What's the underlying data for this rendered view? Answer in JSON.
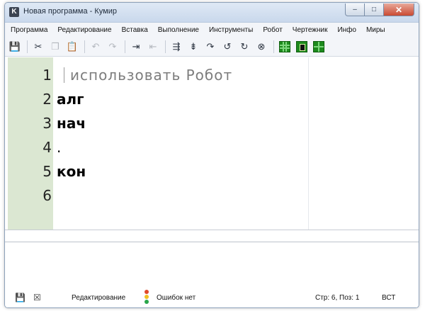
{
  "window": {
    "title": "Новая программа - Кумир",
    "app_icon_letter": "K",
    "minimize": "‒",
    "maximize": "□",
    "close": "✕"
  },
  "menu": [
    "Программа",
    "Редактирование",
    "Вставка",
    "Выполнение",
    "Инструменты",
    "Робот",
    "Чертежник",
    "Инфо",
    "Миры"
  ],
  "toolbar": {
    "icons": [
      {
        "name": "save-icon",
        "glyph": "💾",
        "enabled": true
      },
      {
        "name": "cut-icon",
        "glyph": "✂",
        "enabled": true
      },
      {
        "name": "copy-icon",
        "glyph": "❐",
        "enabled": false
      },
      {
        "name": "paste-icon",
        "glyph": "📋",
        "enabled": true
      },
      {
        "name": "undo-icon",
        "glyph": "↶",
        "enabled": false
      },
      {
        "name": "redo-icon",
        "glyph": "↷",
        "enabled": false
      },
      {
        "name": "indent-icon",
        "glyph": "⇥",
        "enabled": true
      },
      {
        "name": "unindent-icon",
        "glyph": "⇤",
        "enabled": false
      },
      {
        "name": "run-icon",
        "glyph": "⇶",
        "enabled": true
      },
      {
        "name": "run-step-icon",
        "glyph": "⇟",
        "enabled": true
      },
      {
        "name": "step-in-icon",
        "glyph": "↷",
        "enabled": true
      },
      {
        "name": "step-out-icon",
        "glyph": "↺",
        "enabled": true
      },
      {
        "name": "step-over-icon",
        "glyph": "↻",
        "enabled": true
      },
      {
        "name": "stop-icon",
        "glyph": "⊗",
        "enabled": true
      }
    ],
    "world_icons": [
      "grid-world-icon",
      "robot-world-icon",
      "drawer-world-icon"
    ]
  },
  "editor": {
    "lines": [
      {
        "num": "1",
        "text": "использовать Робот",
        "type": "comment"
      },
      {
        "num": "2",
        "text": "алг",
        "type": "keyword"
      },
      {
        "num": "3",
        "text": "нач",
        "type": "keyword"
      },
      {
        "num": "4",
        "text": ".",
        "type": "plain"
      },
      {
        "num": "5",
        "text": "кон",
        "type": "keyword"
      },
      {
        "num": "6",
        "text": "",
        "type": "plain"
      }
    ]
  },
  "status": {
    "mode": "Редактирование",
    "errors": "Ошибок нет",
    "position": "Стр: 6, Поз: 1",
    "insert_mode": "ВСТ"
  },
  "colors": {
    "gutter": "#dbe7d2",
    "title_bar": "#c9d8ec",
    "close_button": "#c94a32"
  }
}
